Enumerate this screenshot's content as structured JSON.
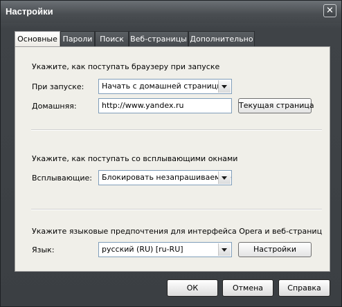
{
  "window": {
    "title": "Настройки",
    "close_glyph": "✕"
  },
  "tabs": [
    {
      "label": "Основные",
      "active": true
    },
    {
      "label": "Пароли"
    },
    {
      "label": "Поиск"
    },
    {
      "label": "Веб-страницы"
    },
    {
      "label": "Дополнительно"
    }
  ],
  "startup": {
    "heading": "Укажите, как поступать браузеру при запуске",
    "on_start_label": "При запуске:",
    "on_start_value": "Начать с домашней страницы",
    "home_label": "Домашняя:",
    "home_value": "http://www.yandex.ru",
    "current_page_button": "Текущая страница"
  },
  "popups": {
    "heading": "Укажите, как поступать со всплывающими окнами",
    "label": "Всплывающие:",
    "value": "Блокировать незапрашиваемые"
  },
  "language": {
    "heading": "Укажите языковые предпочтения для интерфейса Opera и веб-страниц",
    "label": "Язык:",
    "value": "русский (RU) [ru-RU]",
    "settings_button": "Настройки"
  },
  "footer": {
    "ok": "ОК",
    "cancel": "Отмена",
    "help": "Справка"
  }
}
